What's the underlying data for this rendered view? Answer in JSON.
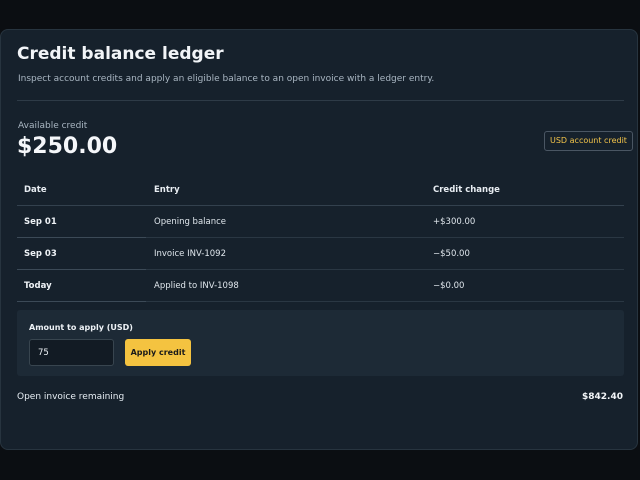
{
  "header": {
    "title": "Credit balance ledger",
    "subtitle": "Inspect account credits and apply an eligible balance to an open invoice with a ledger entry."
  },
  "balance": {
    "label": "Available credit",
    "value": "$250.00",
    "badge": "USD account credit"
  },
  "ledger": {
    "columns": [
      "Date",
      "Entry",
      "Credit change"
    ],
    "rows": [
      {
        "date": "Sep 01",
        "entry": "Opening balance",
        "change": "+$300.00"
      },
      {
        "date": "Sep 03",
        "entry": "Invoice INV-1092",
        "change": "−$50.00"
      },
      {
        "date": "Today",
        "entry": "Applied to INV-1098",
        "change": "−$0.00"
      }
    ]
  },
  "apply": {
    "label": "Amount to apply (USD)",
    "amount_value": "75",
    "button_label": "Apply credit"
  },
  "invoice": {
    "remaining_label": "Open invoice remaining",
    "remaining_value": "$842.40"
  },
  "colors": {
    "accent": "#f4c340",
    "card_bg": "#16212c",
    "page_bg": "#0b0e12"
  }
}
